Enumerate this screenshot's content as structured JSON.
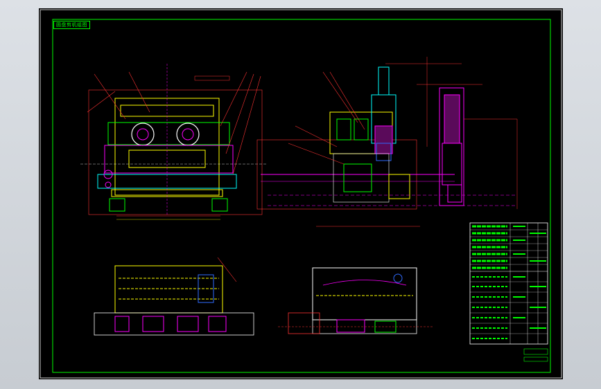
{
  "drawing": {
    "title_block_label": "圆盘剪机组图",
    "bottom_label": "",
    "colors": {
      "background": "#000000",
      "frame": "#00ff00",
      "lines": "#ffff00",
      "accent": "#ff00ff",
      "dimension": "#ff3333",
      "blue": "#2f6bff",
      "white": "#ffffff",
      "cyan": "#00ffff"
    }
  }
}
